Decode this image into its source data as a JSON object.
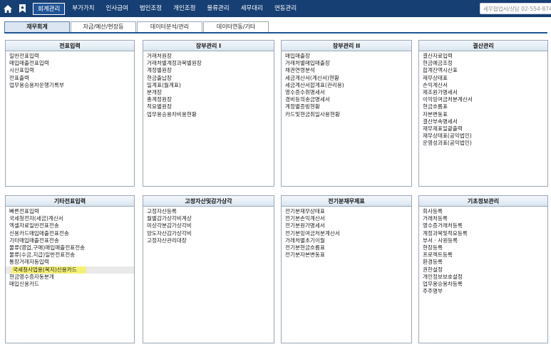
{
  "topnav": {
    "items": [
      "회계관리",
      "부가가치",
      "인사급여",
      "법인조정",
      "개인조정",
      "물류관리",
      "세무대리",
      "연동관리"
    ],
    "search_placeholder": "세무협업서/상담 02-554-874"
  },
  "subtabs": [
    "재무회계",
    "자금/예산/현장등",
    "데이터분석/관리",
    "데이터연동/기타"
  ],
  "panels": [
    {
      "title": "전표입력",
      "items": [
        "일반전표입력",
        "매입매출전표입력",
        "시산표입력",
        "전표출력",
        "업무용승용차운행기록부"
      ]
    },
    {
      "title": "장부관리 I",
      "items": [
        "거래처원장",
        "거래처별계정과목별원장",
        "계정별원장",
        "현금출납장",
        "일계표(월계표)",
        "분개장",
        "총계정원장",
        "적요별원장",
        "업무용승용차비용현황"
      ]
    },
    {
      "title": "장부관리 II",
      "items": [
        "매입매출장",
        "거래처별매입매출장",
        "채권연령분석",
        "세금계산서(계산서)현황",
        "세금계산서합계표(관리용)",
        "영수증수취명세서",
        "경비등의송금명세서",
        "계정별증빙현황",
        "카드및현금취일사용현황"
      ]
    },
    {
      "title": "결산관리",
      "items": [
        "결산자료입력",
        "현금예금조정",
        "합계잔액시산표",
        "재무상태표",
        "손익계산서",
        "제조원가명세서",
        "이익잉여금처분계산서",
        "현금흐름표",
        "자본변동표",
        "결산부속명세서",
        "재무제표일괄출력",
        "재무상태표(공익법인)",
        "운영성과표(공익법인)"
      ]
    },
    {
      "title": "기타전표입력",
      "items": [
        "빠른전표입력",
        "국세청전자(세금)계산서",
        "엑셀자료일반전표전송",
        "신용카드매입매출전표전송",
        "기타매입매출전표전송",
        "물류(영업,구매)매입매출전표전송",
        "물류(수금,지급)일반전표전송",
        "통장거래자동입력",
        "국세청사업용(복지)신용카드",
        "현금영수증자동분개",
        "매입신용카드"
      ]
    },
    {
      "title": "고정자산및감가상각",
      "items": [
        "고정자산등록",
        "월별감가상각비계상",
        "미상각분감가상각비",
        "양도자산감가상각비",
        "고정자산관리대장"
      ]
    },
    {
      "title": "전기분재무제표",
      "items": [
        "전기분재무상태표",
        "전기분손익계산서",
        "전기분원가명세서",
        "전기분잉여금처분계산서",
        "거래처별초기이월",
        "전기분현금흐름표",
        "전기분자본변동표"
      ]
    },
    {
      "title": "기초정보관리",
      "items": [
        "회사등록",
        "거래처등록",
        "영수증거래처등록",
        "계정과목및적요등록",
        "부서 · 사원등록",
        "현장등록",
        "프로젝트등록",
        "환경등록",
        "권한설정",
        "개인정보보호설정",
        "업무용승용차등록",
        "주주명부"
      ]
    }
  ]
}
